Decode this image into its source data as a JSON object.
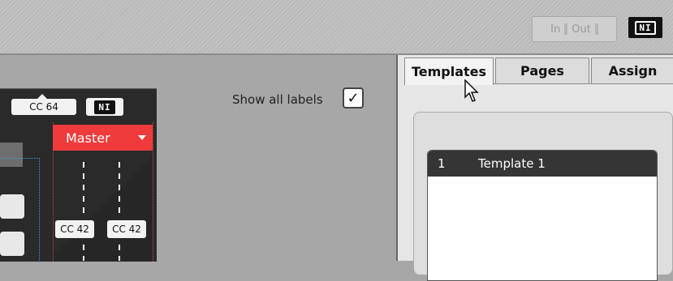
{
  "topbar": {
    "in_label": "In",
    "out_label": "Out",
    "logo_text": "NI"
  },
  "panel": {
    "cc_top": "CC 64",
    "logo_text": "NI",
    "master_label": "Master",
    "cc_left": "CC 42",
    "cc_right": "CC 42"
  },
  "options": {
    "show_all_labels": "Show all labels",
    "check_mark": "✓"
  },
  "tabs": [
    {
      "label": "Templates",
      "active": true
    },
    {
      "label": "Pages",
      "active": false
    },
    {
      "label": "Assign",
      "active": false
    }
  ],
  "templates": [
    {
      "number": "1",
      "name": "Template 1"
    }
  ],
  "colors": {
    "master_red": "#ef3b3b",
    "panel_dark": "#2a2a2a",
    "accent_dotted": "#3aa0d0"
  }
}
